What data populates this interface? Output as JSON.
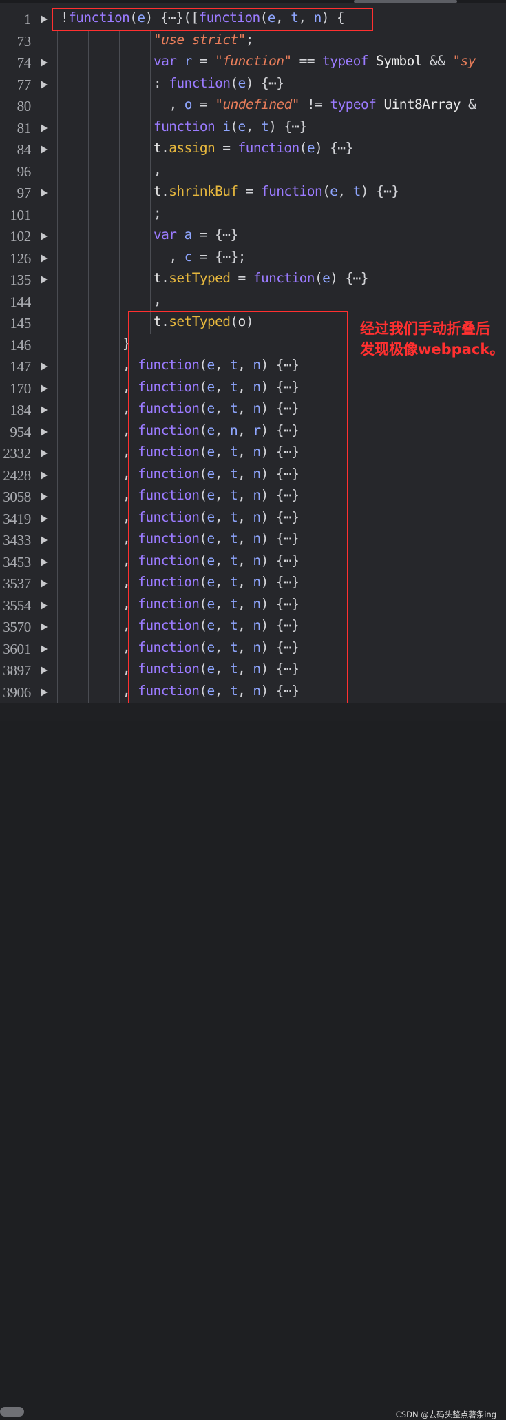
{
  "lines": [
    {
      "ln": "1",
      "fold": true,
      "indent": 1,
      "tokens": [
        [
          "pn",
          "!"
        ],
        [
          "kw",
          "function"
        ],
        [
          "pn",
          "("
        ],
        [
          "vr",
          "e"
        ],
        [
          "pn",
          ") {"
        ],
        [
          "pn",
          "⋯"
        ],
        [
          "pn",
          "}(["
        ],
        [
          "kw",
          "function"
        ],
        [
          "pn",
          "("
        ],
        [
          "vr",
          "e"
        ],
        [
          "pn",
          ", "
        ],
        [
          "vr",
          "t"
        ],
        [
          "pn",
          ", "
        ],
        [
          "vr",
          "n"
        ],
        [
          "pn",
          ") {"
        ]
      ]
    },
    {
      "ln": "73",
      "fold": false,
      "indent": 4,
      "tokens": [
        [
          "st",
          "\"use strict\""
        ],
        [
          "pn",
          ";"
        ]
      ]
    },
    {
      "ln": "74",
      "fold": true,
      "indent": 4,
      "tokens": [
        [
          "kw",
          "var "
        ],
        [
          "vr",
          "r"
        ],
        [
          "pn",
          " = "
        ],
        [
          "st",
          "\"function\""
        ],
        [
          "pn",
          " == "
        ],
        [
          "kw",
          "typeof "
        ],
        [
          "id",
          "Symbol"
        ],
        [
          "pn",
          " && "
        ],
        [
          "st",
          "\"sy"
        ]
      ]
    },
    {
      "ln": "77",
      "fold": true,
      "indent": 4,
      "tokens": [
        [
          "pn",
          ": "
        ],
        [
          "kw",
          "function"
        ],
        [
          "pn",
          "("
        ],
        [
          "vr",
          "e"
        ],
        [
          "pn",
          ") {"
        ],
        [
          "pn",
          "⋯"
        ],
        [
          "pn",
          "}"
        ]
      ]
    },
    {
      "ln": "80",
      "fold": false,
      "indent": 4.5,
      "tokens": [
        [
          "pn",
          ", "
        ],
        [
          "vr",
          "o"
        ],
        [
          "pn",
          " = "
        ],
        [
          "st",
          "\"undefined\""
        ],
        [
          "pn",
          " != "
        ],
        [
          "kw",
          "typeof "
        ],
        [
          "id",
          "Uint8Array"
        ],
        [
          "pn",
          " &"
        ]
      ]
    },
    {
      "ln": "81",
      "fold": true,
      "indent": 4,
      "tokens": [
        [
          "kw",
          "function "
        ],
        [
          "vr",
          "i"
        ],
        [
          "pn",
          "("
        ],
        [
          "vr",
          "e"
        ],
        [
          "pn",
          ", "
        ],
        [
          "vr",
          "t"
        ],
        [
          "pn",
          ") {"
        ],
        [
          "pn",
          "⋯"
        ],
        [
          "pn",
          "}"
        ]
      ]
    },
    {
      "ln": "84",
      "fold": true,
      "indent": 4,
      "tokens": [
        [
          "id",
          "t"
        ],
        [
          "pn",
          "."
        ],
        [
          "fn",
          "assign"
        ],
        [
          "pn",
          " = "
        ],
        [
          "kw",
          "function"
        ],
        [
          "pn",
          "("
        ],
        [
          "vr",
          "e"
        ],
        [
          "pn",
          ") {"
        ],
        [
          "pn",
          "⋯"
        ],
        [
          "pn",
          "}"
        ]
      ]
    },
    {
      "ln": "96",
      "fold": false,
      "indent": 4,
      "tokens": [
        [
          "pn",
          ","
        ]
      ]
    },
    {
      "ln": "97",
      "fold": true,
      "indent": 4,
      "tokens": [
        [
          "id",
          "t"
        ],
        [
          "pn",
          "."
        ],
        [
          "fn",
          "shrinkBuf"
        ],
        [
          "pn",
          " = "
        ],
        [
          "kw",
          "function"
        ],
        [
          "pn",
          "("
        ],
        [
          "vr",
          "e"
        ],
        [
          "pn",
          ", "
        ],
        [
          "vr",
          "t"
        ],
        [
          "pn",
          ") {"
        ],
        [
          "pn",
          "⋯"
        ],
        [
          "pn",
          "}"
        ]
      ]
    },
    {
      "ln": "101",
      "fold": false,
      "indent": 4,
      "tokens": [
        [
          "pn",
          ";"
        ]
      ]
    },
    {
      "ln": "102",
      "fold": true,
      "indent": 4,
      "tokens": [
        [
          "kw",
          "var "
        ],
        [
          "vr",
          "a"
        ],
        [
          "pn",
          " = {"
        ],
        [
          "pn",
          "⋯"
        ],
        [
          "pn",
          "}"
        ]
      ]
    },
    {
      "ln": "126",
      "fold": true,
      "indent": 4.5,
      "tokens": [
        [
          "pn",
          ", "
        ],
        [
          "vr",
          "c"
        ],
        [
          "pn",
          " = {"
        ],
        [
          "pn",
          "⋯"
        ],
        [
          "pn",
          "};"
        ]
      ]
    },
    {
      "ln": "135",
      "fold": true,
      "indent": 4,
      "tokens": [
        [
          "id",
          "t"
        ],
        [
          "pn",
          "."
        ],
        [
          "fn",
          "setTyped"
        ],
        [
          "pn",
          " = "
        ],
        [
          "kw",
          "function"
        ],
        [
          "pn",
          "("
        ],
        [
          "vr",
          "e"
        ],
        [
          "pn",
          ") {"
        ],
        [
          "pn",
          "⋯"
        ],
        [
          "pn",
          "}"
        ]
      ]
    },
    {
      "ln": "144",
      "fold": false,
      "indent": 4,
      "tokens": [
        [
          "pn",
          ","
        ]
      ]
    },
    {
      "ln": "145",
      "fold": false,
      "indent": 4,
      "tokens": [
        [
          "id",
          "t"
        ],
        [
          "pn",
          "."
        ],
        [
          "fn",
          "setTyped"
        ],
        [
          "pn",
          "("
        ],
        [
          "id",
          "o"
        ],
        [
          "pn",
          ")"
        ]
      ]
    },
    {
      "ln": "146",
      "fold": false,
      "indent": 3,
      "tokens": [
        [
          "pn",
          "}"
        ]
      ]
    },
    {
      "ln": "147",
      "fold": true,
      "indent": 3,
      "tokens": [
        [
          "pn",
          ", "
        ],
        [
          "kw",
          "function"
        ],
        [
          "pn",
          "("
        ],
        [
          "vr",
          "e"
        ],
        [
          "pn",
          ", "
        ],
        [
          "vr",
          "t"
        ],
        [
          "pn",
          ", "
        ],
        [
          "vr",
          "n"
        ],
        [
          "pn",
          ") {"
        ],
        [
          "pn",
          "⋯"
        ],
        [
          "pn",
          "}"
        ]
      ]
    },
    {
      "ln": "170",
      "fold": true,
      "indent": 3,
      "tokens": [
        [
          "pn",
          ", "
        ],
        [
          "kw",
          "function"
        ],
        [
          "pn",
          "("
        ],
        [
          "vr",
          "e"
        ],
        [
          "pn",
          ", "
        ],
        [
          "vr",
          "t"
        ],
        [
          "pn",
          ", "
        ],
        [
          "vr",
          "n"
        ],
        [
          "pn",
          ") {"
        ],
        [
          "pn",
          "⋯"
        ],
        [
          "pn",
          "}"
        ]
      ]
    },
    {
      "ln": "184",
      "fold": true,
      "indent": 3,
      "tokens": [
        [
          "pn",
          ", "
        ],
        [
          "kw",
          "function"
        ],
        [
          "pn",
          "("
        ],
        [
          "vr",
          "e"
        ],
        [
          "pn",
          ", "
        ],
        [
          "vr",
          "t"
        ],
        [
          "pn",
          ", "
        ],
        [
          "vr",
          "n"
        ],
        [
          "pn",
          ") {"
        ],
        [
          "pn",
          "⋯"
        ],
        [
          "pn",
          "}"
        ]
      ]
    },
    {
      "ln": "954",
      "fold": true,
      "indent": 3,
      "tokens": [
        [
          "pn",
          ", "
        ],
        [
          "kw",
          "function"
        ],
        [
          "pn",
          "("
        ],
        [
          "vr",
          "e"
        ],
        [
          "pn",
          ", "
        ],
        [
          "vr",
          "n"
        ],
        [
          "pn",
          ", "
        ],
        [
          "vr",
          "r"
        ],
        [
          "pn",
          ") {"
        ],
        [
          "pn",
          "⋯"
        ],
        [
          "pn",
          "}"
        ]
      ]
    },
    {
      "ln": "2332",
      "fold": true,
      "indent": 3,
      "tokens": [
        [
          "pn",
          ", "
        ],
        [
          "kw",
          "function"
        ],
        [
          "pn",
          "("
        ],
        [
          "vr",
          "e"
        ],
        [
          "pn",
          ", "
        ],
        [
          "vr",
          "t"
        ],
        [
          "pn",
          ", "
        ],
        [
          "vr",
          "n"
        ],
        [
          "pn",
          ") {"
        ],
        [
          "pn",
          "⋯"
        ],
        [
          "pn",
          "}"
        ]
      ]
    },
    {
      "ln": "2428",
      "fold": true,
      "indent": 3,
      "tokens": [
        [
          "pn",
          ", "
        ],
        [
          "kw",
          "function"
        ],
        [
          "pn",
          "("
        ],
        [
          "vr",
          "e"
        ],
        [
          "pn",
          ", "
        ],
        [
          "vr",
          "t"
        ],
        [
          "pn",
          ", "
        ],
        [
          "vr",
          "n"
        ],
        [
          "pn",
          ") {"
        ],
        [
          "pn",
          "⋯"
        ],
        [
          "pn",
          "}"
        ]
      ]
    },
    {
      "ln": "3058",
      "fold": true,
      "indent": 3,
      "tokens": [
        [
          "pn",
          ", "
        ],
        [
          "kw",
          "function"
        ],
        [
          "pn",
          "("
        ],
        [
          "vr",
          "e"
        ],
        [
          "pn",
          ", "
        ],
        [
          "vr",
          "t"
        ],
        [
          "pn",
          ", "
        ],
        [
          "vr",
          "n"
        ],
        [
          "pn",
          ") {"
        ],
        [
          "pn",
          "⋯"
        ],
        [
          "pn",
          "}"
        ]
      ]
    },
    {
      "ln": "3419",
      "fold": true,
      "indent": 3,
      "tokens": [
        [
          "pn",
          ", "
        ],
        [
          "kw",
          "function"
        ],
        [
          "pn",
          "("
        ],
        [
          "vr",
          "e"
        ],
        [
          "pn",
          ", "
        ],
        [
          "vr",
          "t"
        ],
        [
          "pn",
          ", "
        ],
        [
          "vr",
          "n"
        ],
        [
          "pn",
          ") {"
        ],
        [
          "pn",
          "⋯"
        ],
        [
          "pn",
          "}"
        ]
      ]
    },
    {
      "ln": "3433",
      "fold": true,
      "indent": 3,
      "tokens": [
        [
          "pn",
          ", "
        ],
        [
          "kw",
          "function"
        ],
        [
          "pn",
          "("
        ],
        [
          "vr",
          "e"
        ],
        [
          "pn",
          ", "
        ],
        [
          "vr",
          "t"
        ],
        [
          "pn",
          ", "
        ],
        [
          "vr",
          "n"
        ],
        [
          "pn",
          ") {"
        ],
        [
          "pn",
          "⋯"
        ],
        [
          "pn",
          "}"
        ]
      ]
    },
    {
      "ln": "3453",
      "fold": true,
      "indent": 3,
      "tokens": [
        [
          "pn",
          ", "
        ],
        [
          "kw",
          "function"
        ],
        [
          "pn",
          "("
        ],
        [
          "vr",
          "e"
        ],
        [
          "pn",
          ", "
        ],
        [
          "vr",
          "t"
        ],
        [
          "pn",
          ", "
        ],
        [
          "vr",
          "n"
        ],
        [
          "pn",
          ") {"
        ],
        [
          "pn",
          "⋯"
        ],
        [
          "pn",
          "}"
        ]
      ]
    },
    {
      "ln": "3537",
      "fold": true,
      "indent": 3,
      "tokens": [
        [
          "pn",
          ", "
        ],
        [
          "kw",
          "function"
        ],
        [
          "pn",
          "("
        ],
        [
          "vr",
          "e"
        ],
        [
          "pn",
          ", "
        ],
        [
          "vr",
          "t"
        ],
        [
          "pn",
          ", "
        ],
        [
          "vr",
          "n"
        ],
        [
          "pn",
          ") {"
        ],
        [
          "pn",
          "⋯"
        ],
        [
          "pn",
          "}"
        ]
      ]
    },
    {
      "ln": "3554",
      "fold": true,
      "indent": 3,
      "tokens": [
        [
          "pn",
          ", "
        ],
        [
          "kw",
          "function"
        ],
        [
          "pn",
          "("
        ],
        [
          "vr",
          "e"
        ],
        [
          "pn",
          ", "
        ],
        [
          "vr",
          "t"
        ],
        [
          "pn",
          ", "
        ],
        [
          "vr",
          "n"
        ],
        [
          "pn",
          ") {"
        ],
        [
          "pn",
          "⋯"
        ],
        [
          "pn",
          "}"
        ]
      ]
    },
    {
      "ln": "3570",
      "fold": true,
      "indent": 3,
      "tokens": [
        [
          "pn",
          ", "
        ],
        [
          "kw",
          "function"
        ],
        [
          "pn",
          "("
        ],
        [
          "vr",
          "e"
        ],
        [
          "pn",
          ", "
        ],
        [
          "vr",
          "t"
        ],
        [
          "pn",
          ", "
        ],
        [
          "vr",
          "n"
        ],
        [
          "pn",
          ") {"
        ],
        [
          "pn",
          "⋯"
        ],
        [
          "pn",
          "}"
        ]
      ]
    },
    {
      "ln": "3601",
      "fold": true,
      "indent": 3,
      "tokens": [
        [
          "pn",
          ", "
        ],
        [
          "kw",
          "function"
        ],
        [
          "pn",
          "("
        ],
        [
          "vr",
          "e"
        ],
        [
          "pn",
          ", "
        ],
        [
          "vr",
          "t"
        ],
        [
          "pn",
          ", "
        ],
        [
          "vr",
          "n"
        ],
        [
          "pn",
          ") {"
        ],
        [
          "pn",
          "⋯"
        ],
        [
          "pn",
          "}"
        ]
      ]
    },
    {
      "ln": "3897",
      "fold": true,
      "indent": 3,
      "tokens": [
        [
          "pn",
          ", "
        ],
        [
          "kw",
          "function"
        ],
        [
          "pn",
          "("
        ],
        [
          "vr",
          "e"
        ],
        [
          "pn",
          ", "
        ],
        [
          "vr",
          "t"
        ],
        [
          "pn",
          ", "
        ],
        [
          "vr",
          "n"
        ],
        [
          "pn",
          ") {"
        ],
        [
          "pn",
          "⋯"
        ],
        [
          "pn",
          "}"
        ]
      ]
    },
    {
      "ln": "3906",
      "fold": true,
      "indent": 3,
      "tokens": [
        [
          "pn",
          ", "
        ],
        [
          "kw",
          "function"
        ],
        [
          "pn",
          "("
        ],
        [
          "vr",
          "e"
        ],
        [
          "pn",
          ", "
        ],
        [
          "vr",
          "t"
        ],
        [
          "pn",
          ", "
        ],
        [
          "vr",
          "n"
        ],
        [
          "pn",
          ") {"
        ],
        [
          "pn",
          "⋯"
        ],
        [
          "pn",
          "}"
        ]
      ]
    }
  ],
  "annotation": {
    "line1": "经过我们手动折叠后",
    "line2": "发现极像webpack。"
  },
  "watermark": "CSDN @去码头整点薯条ing",
  "colors": {
    "highlight_box": "#ff3030",
    "background": "#26272b",
    "keyword": "#9b7bff",
    "string": "#ea7e5b",
    "property": "#e7b83e"
  }
}
